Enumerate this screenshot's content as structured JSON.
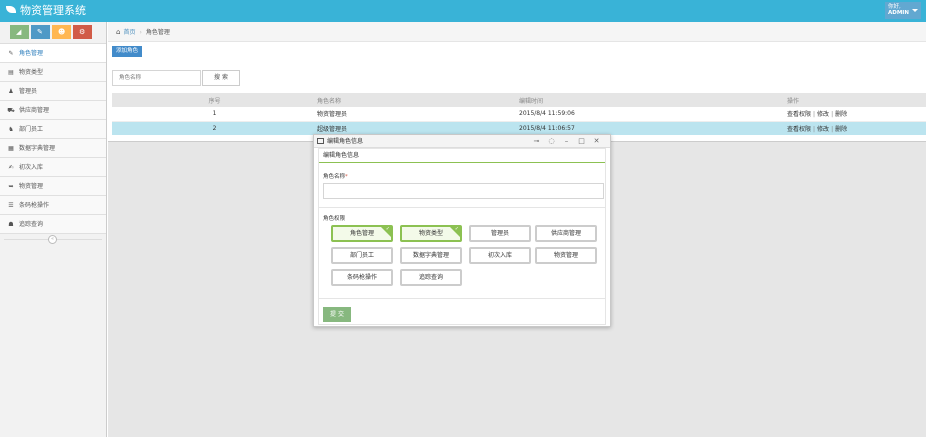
{
  "app": {
    "title": "物资管理系统",
    "user_greeting": "你好,",
    "user_name": "ADMIN"
  },
  "breadcrumb": {
    "home": "首页",
    "current": "角色管理"
  },
  "sidebar": {
    "shortcuts": [
      {
        "icon": "chart-icon",
        "color": "#87b87f"
      },
      {
        "icon": "pencil-icon",
        "color": "#4f99c6"
      },
      {
        "icon": "users-icon",
        "color": "#ffb752"
      },
      {
        "icon": "cogs-icon",
        "color": "#d15b47"
      }
    ],
    "items": [
      {
        "label": "角色管理",
        "icon": "✎"
      },
      {
        "label": "物资类型",
        "icon": "▤"
      },
      {
        "label": "管理员",
        "icon": "♟"
      },
      {
        "label": "供应商管理",
        "icon": "⛟"
      },
      {
        "label": "部门员工",
        "icon": "♞"
      },
      {
        "label": "数据字典管理",
        "icon": "▦"
      },
      {
        "label": "初次入库",
        "icon": "✍"
      },
      {
        "label": "物资管理",
        "icon": "➥"
      },
      {
        "label": "条码枪操作",
        "icon": "☰"
      },
      {
        "label": "追踪查询",
        "icon": "☗"
      }
    ],
    "collapse_glyph": "«"
  },
  "toolbar": {
    "add_label": "添加角色",
    "search_placeholder": "角色名称",
    "search_label": "搜 索"
  },
  "table": {
    "headers": [
      "序号",
      "角色名称",
      "编辑时间",
      "操作"
    ],
    "rows": [
      {
        "no": "1",
        "name": "物资管理员",
        "time": "2015/8/4 11:59:06"
      },
      {
        "no": "2",
        "name": "超级管理员",
        "time": "2015/8/4 11:06:57"
      }
    ],
    "actions": [
      "查看权限",
      "修改",
      "删除"
    ]
  },
  "dialog": {
    "title": "编辑角色信息",
    "tools": [
      "⊸",
      "◌",
      "–",
      "□",
      "✕"
    ],
    "form_title": "编辑角色信息",
    "name_label": "角色名称",
    "required_mark": "*",
    "name_value": "",
    "perm_label": "角色权限",
    "tick": "✓",
    "permissions": [
      {
        "label": "角色管理",
        "checked": true
      },
      {
        "label": "物资类型",
        "checked": true
      },
      {
        "label": "管理员",
        "checked": false
      },
      {
        "label": "供应商管理",
        "checked": false
      },
      {
        "label": "部门员工",
        "checked": false
      },
      {
        "label": "数据字典管理",
        "checked": false
      },
      {
        "label": "初次入库",
        "checked": false
      },
      {
        "label": "物资管理",
        "checked": false
      },
      {
        "label": "条码枪操作",
        "checked": false
      },
      {
        "label": "追踪查询",
        "checked": false
      }
    ],
    "submit_label": "提 交"
  }
}
